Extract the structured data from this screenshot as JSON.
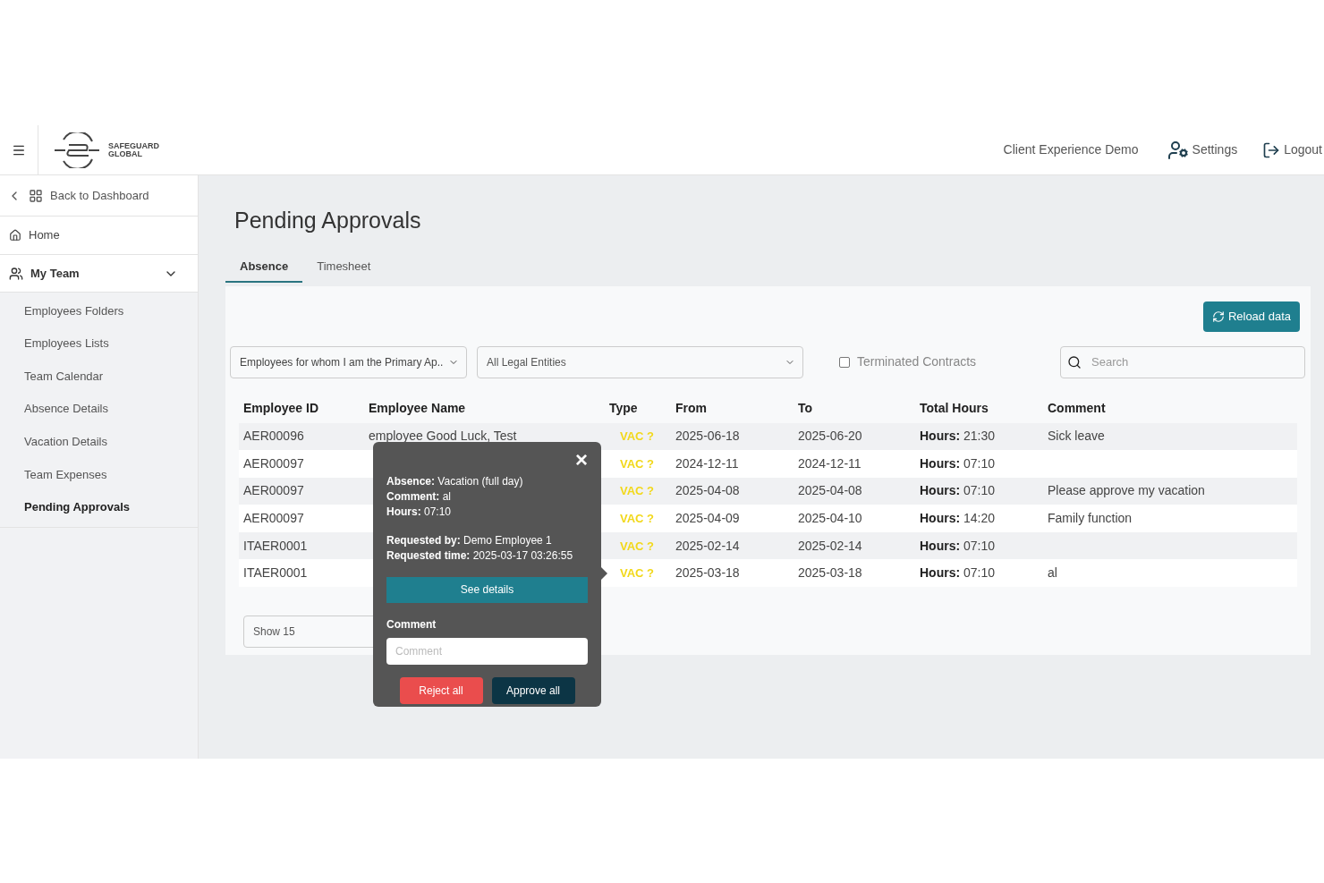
{
  "header": {
    "logo_text": [
      "SAFEGUARD",
      "GLOBAL"
    ],
    "client": "Client Experience Demo",
    "settings": "Settings",
    "logout": "Logout"
  },
  "sidebar": {
    "back": "Back to Dashboard",
    "home": "Home",
    "section": {
      "label": "My Team",
      "expanded": true
    },
    "items": [
      {
        "label": "Employees Folders",
        "selected": false
      },
      {
        "label": "Employees Lists",
        "selected": false
      },
      {
        "label": "Team Calendar",
        "selected": false
      },
      {
        "label": "Absence Details",
        "selected": false
      },
      {
        "label": "Vacation Details",
        "selected": false
      },
      {
        "label": "Team Expenses",
        "selected": false
      },
      {
        "label": "Pending Approvals",
        "selected": true
      }
    ]
  },
  "page_title": "Pending Approvals",
  "tabs": [
    {
      "label": "Absence",
      "selected": true
    },
    {
      "label": "Timesheet",
      "selected": false
    }
  ],
  "reload_button": "Reload data",
  "filters": {
    "approver": "Employees for whom I am the Primary Ap..",
    "entity": "All Legal Entities",
    "terminated": {
      "label": "Terminated Contracts",
      "checked": false
    },
    "search": {
      "placeholder": "Search"
    }
  },
  "table": {
    "columns": [
      "Employee ID",
      "Employee Name",
      "Type",
      "From",
      "To",
      "Total Hours",
      "Comment"
    ],
    "rows": [
      {
        "id": "AER00096",
        "name": "employee Good Luck, Test",
        "type": "VAC ?",
        "from": "2025-06-18",
        "to": "2025-06-20",
        "hours_label": "Hours:",
        "hours": "21:30",
        "comment": "Sick leave"
      },
      {
        "id": "AER00097",
        "type": "VAC ?",
        "from": "2024-12-11",
        "to": "2024-12-11",
        "hours_label": "Hours:",
        "hours": "07:10"
      },
      {
        "id": "AER00097",
        "type": "VAC ?",
        "from": "2025-04-08",
        "to": "2025-04-08",
        "hours_label": "Hours:",
        "hours": "07:10",
        "comment": "Please approve my vacation"
      },
      {
        "id": "AER00097",
        "type": "VAC ?",
        "from": "2025-04-09",
        "to": "2025-04-10",
        "hours_label": "Hours:",
        "hours": "14:20",
        "comment": "Family function"
      },
      {
        "id": "ITAER0001",
        "type": "VAC ?",
        "from": "2025-02-14",
        "to": "2025-02-14",
        "hours_label": "Hours:",
        "hours": "07:10"
      },
      {
        "id": "ITAER0001",
        "type": "VAC ?",
        "from": "2025-03-18",
        "to": "2025-03-18",
        "hours_label": "Hours:",
        "hours": "07:10",
        "comment": "al"
      }
    ]
  },
  "page_size": "Show 15",
  "popover": {
    "close": "×",
    "lines": [
      "**Absence:** Vacation (full day)",
      "**Comment:** al",
      "**Hours:** 07:10"
    ],
    "request_lines": [
      "**Requested by:** Demo Employee 1",
      "**Requested time:** 2025-03-17 03:26:55"
    ],
    "details_button": "See details",
    "comment_label": "Comment",
    "comment_placeholder": "Comment",
    "reject": "Reject all",
    "approve": "Approve all"
  }
}
